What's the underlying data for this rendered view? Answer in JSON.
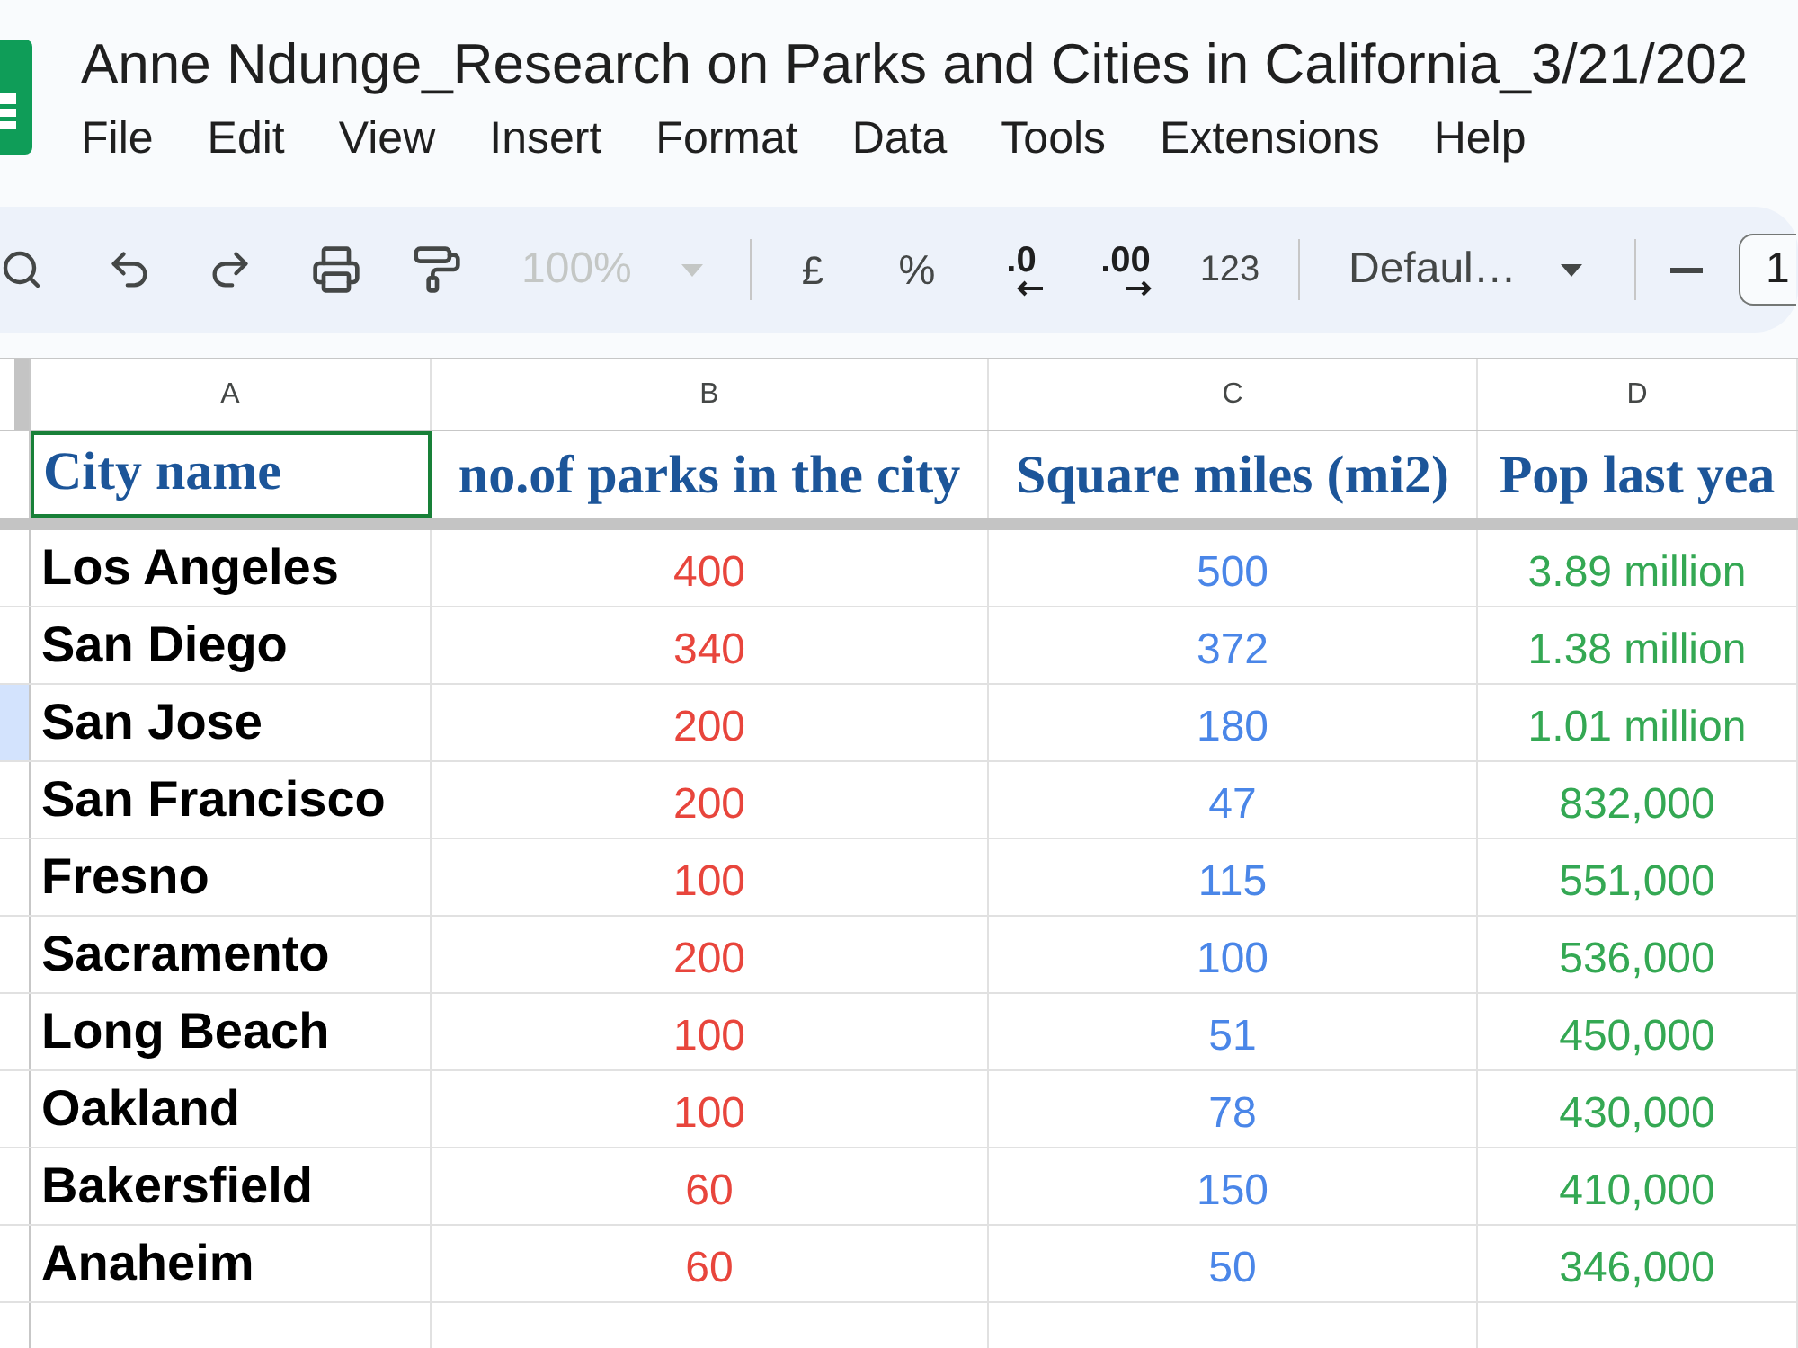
{
  "document": {
    "title": "Anne Ndunge_Research on Parks and Cities in California_3/21/202"
  },
  "menu": [
    "File",
    "Edit",
    "View",
    "Insert",
    "Format",
    "Data",
    "Tools",
    "Extensions",
    "Help"
  ],
  "toolbar": {
    "zoom": {
      "value": "100%",
      "disabled": true
    },
    "formats": [
      {
        "kind": "currency",
        "label": "£"
      },
      {
        "kind": "percent",
        "label": "%"
      },
      {
        "kind": "decrease_decimal",
        "label": ".0"
      },
      {
        "kind": "increase_decimal",
        "label": ".00"
      },
      {
        "kind": "number_format",
        "label": "123"
      }
    ],
    "font": {
      "value": "Defaul…"
    },
    "font_size": {
      "value": "1"
    }
  },
  "sheet": {
    "columns": [
      {
        "letter": "A",
        "heading": "City name",
        "heading_selected": true,
        "kind": "label",
        "color": "#000000"
      },
      {
        "letter": "B",
        "heading": "no.of parks in the city",
        "heading_selected": false,
        "kind": "number",
        "color": "#e8453c"
      },
      {
        "letter": "C",
        "heading": "Square miles (mi2)",
        "heading_selected": false,
        "kind": "number",
        "color": "#4a86e8"
      },
      {
        "letter": "D",
        "heading": "Pop last yea",
        "heading_selected": false,
        "kind": "number",
        "color": "#34a853"
      }
    ],
    "rows": [
      {
        "highlighted": false,
        "cells": [
          "Los Angeles",
          "400",
          "500",
          "3.89 million"
        ]
      },
      {
        "highlighted": false,
        "cells": [
          "San Diego",
          "340",
          "372",
          "1.38 million"
        ]
      },
      {
        "highlighted": true,
        "cells": [
          "San Jose",
          "200",
          "180",
          "1.01 million"
        ]
      },
      {
        "highlighted": false,
        "cells": [
          "San Francisco",
          "200",
          "47",
          "832,000"
        ]
      },
      {
        "highlighted": false,
        "cells": [
          "Fresno",
          "100",
          "115",
          "551,000"
        ]
      },
      {
        "highlighted": false,
        "cells": [
          "Sacramento",
          "200",
          "100",
          "536,000"
        ]
      },
      {
        "highlighted": false,
        "cells": [
          "Long Beach",
          "100",
          "51",
          "450,000"
        ]
      },
      {
        "highlighted": false,
        "cells": [
          "Oakland",
          "100",
          "78",
          "430,000"
        ]
      },
      {
        "highlighted": false,
        "cells": [
          "Bakersfield",
          "60",
          "150",
          "410,000"
        ]
      },
      {
        "highlighted": false,
        "cells": [
          "Anaheim",
          "60",
          "50",
          "346,000"
        ]
      }
    ]
  }
}
